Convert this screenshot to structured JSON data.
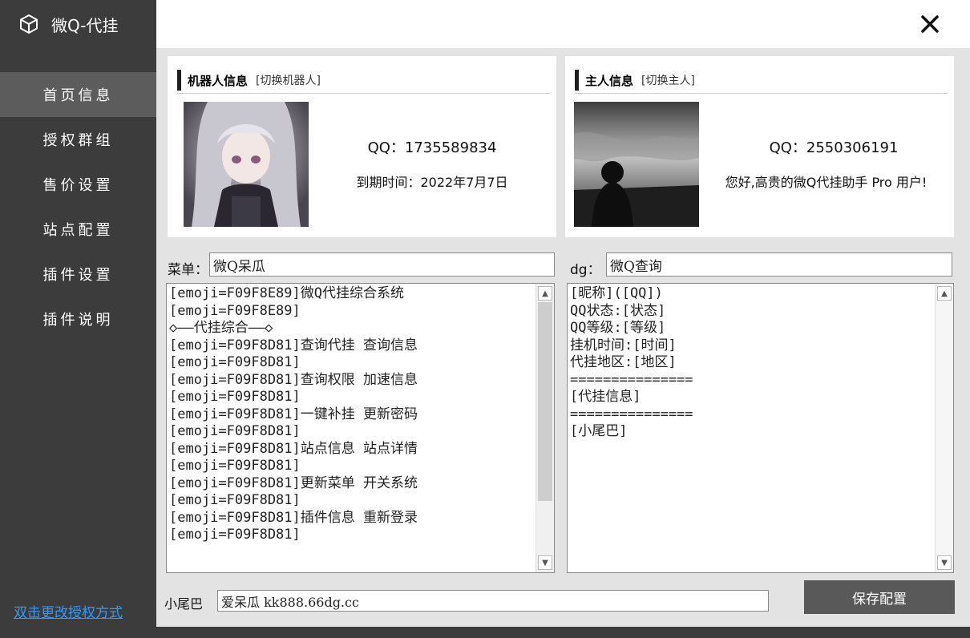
{
  "app": {
    "title": "微Q-代挂"
  },
  "sidebar": {
    "items": [
      {
        "label": "首页信息",
        "active": true
      },
      {
        "label": "授权群组"
      },
      {
        "label": "售价设置"
      },
      {
        "label": "站点配置"
      },
      {
        "label": "插件设置"
      },
      {
        "label": "插件说明"
      }
    ],
    "bottom_link": "双击更改授权方式"
  },
  "window": {
    "close_icon": "close-icon"
  },
  "robot_card": {
    "title": "机器人信息",
    "switch_label": "[切换机器人]",
    "qq": "QQ：1735589834",
    "expiry": "到期时间：2022年7月7日"
  },
  "owner_card": {
    "title": "主人信息",
    "switch_label": "[切换主人]",
    "qq": "QQ：2550306191",
    "greeting": "您好,高贵的微Q代挂助手 Pro 用户!"
  },
  "menu": {
    "label": "菜单：",
    "name_value": "微Q呆瓜",
    "lines": [
      "[emoji=F09F8E89]微Q代挂综合系统",
      "[emoji=F09F8E89]",
      "◇——代挂综合——◇",
      "[emoji=F09F8D81]查询代挂 查询信息",
      "[emoji=F09F8D81]",
      "[emoji=F09F8D81]查询权限 加速信息",
      "[emoji=F09F8D81]",
      "[emoji=F09F8D81]一键补挂 更新密码",
      "[emoji=F09F8D81]",
      "[emoji=F09F8D81]站点信息 站点详情",
      "[emoji=F09F8D81]",
      "[emoji=F09F8D81]更新菜单 开关系统",
      "[emoji=F09F8D81]",
      "[emoji=F09F8D81]插件信息 重新登录",
      "[emoji=F09F8D81]"
    ]
  },
  "dg": {
    "label": "dg：",
    "name_value": "微Q查询",
    "lines": [
      "[昵称]([QQ])",
      "QQ状态:[状态]",
      "QQ等级:[等级]",
      "挂机时间:[时间]",
      "代挂地区:[地区]",
      "===============",
      "[代挂信息]",
      "===============",
      "[小尾巴]"
    ]
  },
  "tail": {
    "label": "小尾巴",
    "value": "爱呆瓜 kk888.66dg.cc"
  },
  "save_label": "保存配置",
  "colors": {
    "sidebar": "#3c3c3c",
    "active": "#5c5c5c",
    "link": "#2e9bff",
    "button": "#595959"
  }
}
